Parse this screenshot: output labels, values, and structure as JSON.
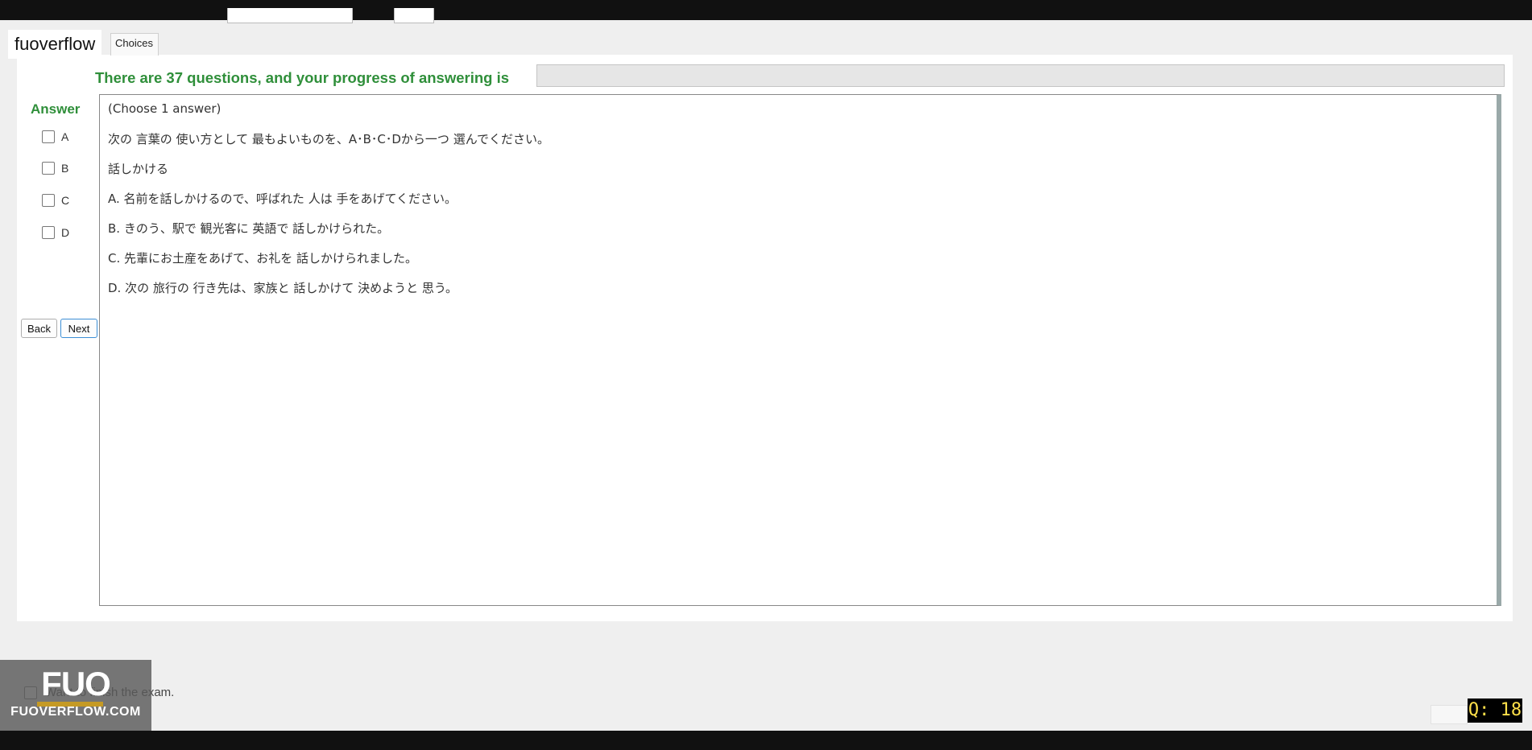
{
  "watermark": {
    "text": "fuoverflow"
  },
  "tabs": [
    {
      "label": "Choices"
    }
  ],
  "progress": {
    "text": "There are 37 questions, and your progress of answering is",
    "value": 0
  },
  "answer_panel": {
    "title": "Answer",
    "options": [
      "A",
      "B",
      "C",
      "D"
    ]
  },
  "nav": {
    "back_label": "Back",
    "next_label": "Next"
  },
  "question": {
    "instruction": "(Choose 1 answer)",
    "prompt": "次の 言葉の 使い方として 最もよいものを、A･B･C･Dから一つ 選んでください。",
    "word": "話しかける",
    "options": [
      "A.  名前を話しかけるので、呼ばれた 人は 手をあげてください。",
      "B.  きのう、駅で 観光客に 英語で 話しかけられた。",
      "C.  先輩にお土産をあげて、お礼を 話しかけられました。",
      "D.  次の 旅行の 行き先は、家族と 話しかけて 決めようと 思う。"
    ]
  },
  "finish": {
    "label": "Want to finish the exam."
  },
  "logo": {
    "big": "FUO",
    "small": "FUOVERFLOW.COM"
  },
  "question_counter": "Q: 18"
}
